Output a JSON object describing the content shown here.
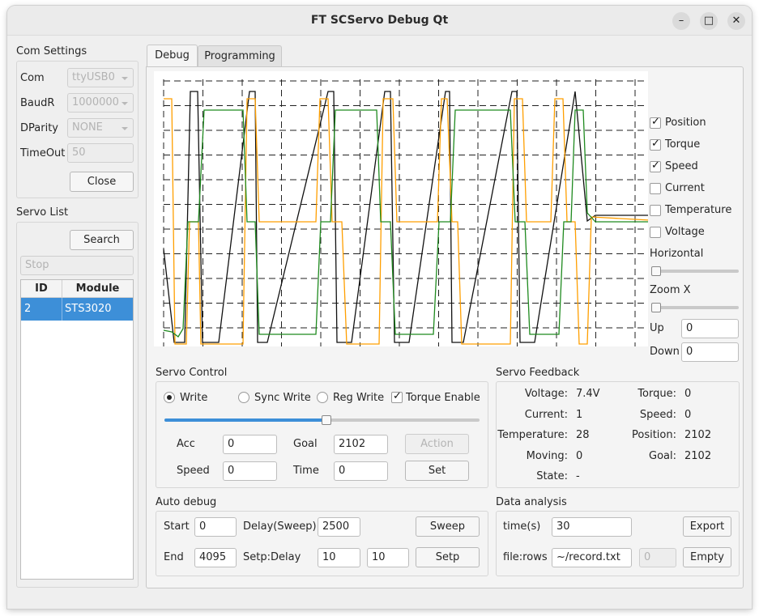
{
  "window": {
    "title": "FT SCServo Debug Qt",
    "minimize_glyph": "–",
    "maximize_glyph": "□",
    "close_glyph": "✕"
  },
  "com_settings": {
    "title": "Com Settings",
    "com_label": "Com",
    "com_value": "ttyUSB0",
    "baud_label": "BaudR",
    "baud_value": "1000000",
    "parity_label": "DParity",
    "parity_value": "NONE",
    "timeout_label": "TimeOut",
    "timeout_value": "50",
    "close_button": "Close"
  },
  "servo_list": {
    "title": "Servo List",
    "search_button": "Search",
    "status_placeholder": "Stop",
    "columns": [
      "ID",
      "Module"
    ],
    "rows": [
      {
        "id": "2",
        "module": "STS3020"
      }
    ],
    "selected_color": "#3d8fd8"
  },
  "tabs": [
    {
      "label": "Debug",
      "active": true
    },
    {
      "label": "Programming",
      "active": false
    }
  ],
  "plot": {
    "series_colors": {
      "position": "#111111",
      "torque": "#ff9f00",
      "speed": "#1f8a1f"
    },
    "checks": [
      {
        "label": "Position",
        "checked": true
      },
      {
        "label": "Torque",
        "checked": true
      },
      {
        "label": "Speed",
        "checked": true
      },
      {
        "label": "Current",
        "checked": false
      },
      {
        "label": "Temperature",
        "checked": false
      },
      {
        "label": "Voltage",
        "checked": false
      }
    ],
    "horizontal_label": "Horizontal",
    "zoom_label": "Zoom X",
    "up_label": "Up",
    "up_value": "0",
    "down_label": "Down",
    "down_value": "0"
  },
  "servo_control": {
    "title": "Servo Control",
    "modes": [
      {
        "label": "Write",
        "checked": true
      },
      {
        "label": "Sync Write",
        "checked": false
      },
      {
        "label": "Reg Write",
        "checked": false
      }
    ],
    "torque_enable_label": "Torque Enable",
    "torque_enable_checked": true,
    "slider_value_fraction": 0.513,
    "acc_label": "Acc",
    "acc_value": "0",
    "goal_label": "Goal",
    "goal_value": "2102",
    "action_button": "Action",
    "speed_label": "Speed",
    "speed_value": "0",
    "time_label": "Time",
    "time_value": "0",
    "set_button": "Set",
    "accent_color": "#3d8fd8"
  },
  "servo_feedback": {
    "title": "Servo Feedback",
    "left": [
      {
        "label": "Voltage:",
        "value": "7.4V"
      },
      {
        "label": "Current:",
        "value": "1"
      },
      {
        "label": "Temperature:",
        "value": "28"
      },
      {
        "label": "Moving:",
        "value": "0"
      },
      {
        "label": "State:",
        "value": "-"
      }
    ],
    "right": [
      {
        "label": "Torque:",
        "value": "0"
      },
      {
        "label": "Speed:",
        "value": "0"
      },
      {
        "label": "Position:",
        "value": "2102"
      },
      {
        "label": "Goal:",
        "value": "2102"
      }
    ]
  },
  "auto_debug": {
    "title": "Auto debug",
    "start_label": "Start",
    "start_value": "0",
    "delay_sweep_label": "Delay(Sweep)",
    "delay_sweep_value": "2500",
    "sweep_button": "Sweep",
    "end_label": "End",
    "end_value": "4095",
    "step_delay_label": "Setp:Delay",
    "step_value": "10",
    "delay_value": "10",
    "step_button": "Setp"
  },
  "data_analysis": {
    "title": "Data analysis",
    "time_label": "time(s)",
    "time_value": "30",
    "export_button": "Export",
    "file_label": "file:rows",
    "file_value": "~/record.txt",
    "rows_value": "0",
    "empty_button": "Empty"
  }
}
